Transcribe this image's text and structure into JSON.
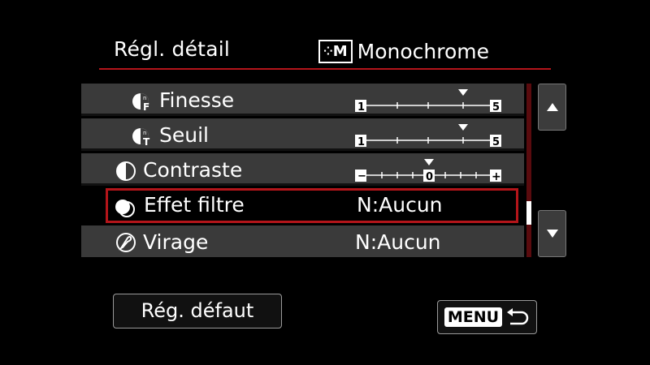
{
  "header": {
    "title": "Régl. détail",
    "mode_badge": "M",
    "mode_name": "Monochrome"
  },
  "rows": [
    {
      "label": "Finesse",
      "kind": "slider",
      "min_label": "1",
      "max_label": "5",
      "value": 4,
      "icon": "sharpness-fineness-icon"
    },
    {
      "label": "Seuil",
      "kind": "slider",
      "min_label": "1",
      "max_label": "5",
      "value": 4,
      "icon": "sharpness-threshold-icon"
    },
    {
      "label": "Contraste",
      "kind": "slider",
      "min_label": "−",
      "center_label": "0",
      "max_label": "+",
      "value": 0,
      "icon": "contrast-icon"
    },
    {
      "label": "Effet filtre",
      "kind": "text",
      "value_text": "N:Aucun",
      "icon": "filter-effect-icon",
      "selected": true
    },
    {
      "label": "Virage",
      "kind": "text",
      "value_text": "N:Aucun",
      "icon": "toning-icon"
    }
  ],
  "buttons": {
    "default": "Rég. défaut",
    "menu": "MENU"
  },
  "colors": {
    "accent": "#b4151a",
    "row_bg": "#3a3a3a"
  }
}
